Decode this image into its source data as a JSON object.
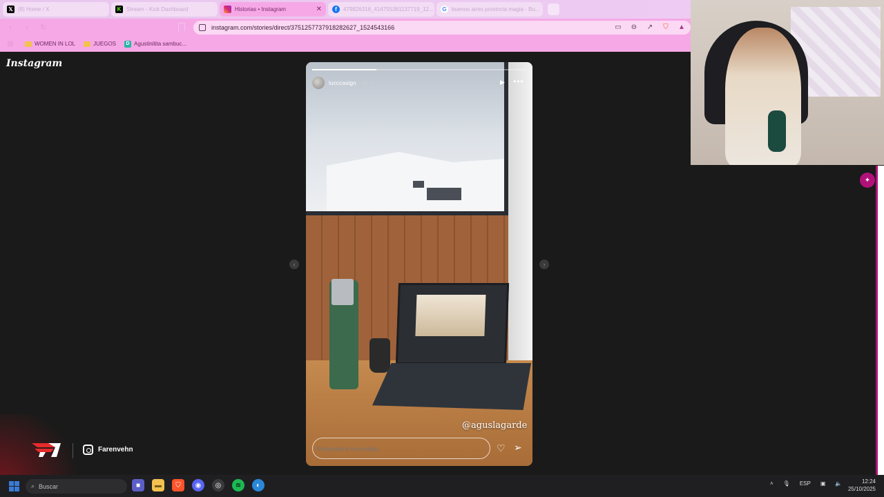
{
  "browser": {
    "tabs": [
      {
        "title": "(8) Home / X",
        "icon": "x-logo-icon"
      },
      {
        "title": "Stream - Kick Dashboard",
        "icon": "kick-logo-icon"
      },
      {
        "title": "Historias • Instagram",
        "icon": "instagram-logo-icon",
        "active": true
      },
      {
        "title": "479826316_414755381137719_12...",
        "icon": "facebook-logo-icon"
      },
      {
        "title": "buenos aires provincia magia - Bu...",
        "icon": "google-logo-icon"
      }
    ],
    "url": "instagram.com/stories/direct/3751257737918282627_1524543166",
    "bookmarks": [
      {
        "label": "WOMEN IN LOL",
        "icon": "folder-icon"
      },
      {
        "label": "JUEGOS",
        "icon": "folder-icon"
      },
      {
        "label": "Agustinitita sambuc...",
        "icon": "d-site-icon"
      }
    ]
  },
  "page": {
    "logo": "Instagram",
    "story": {
      "username": "lucccasign",
      "time": "45 s",
      "progress": 0.3,
      "mention": "@aguslagarde",
      "reply_placeholder": "Responde a lucccasign..."
    }
  },
  "overlay": {
    "brand": "F",
    "instagram_handle": "Farenvehn"
  },
  "taskbar": {
    "search_placeholder": "Buscar",
    "apps": [
      "teams-icon",
      "files-icon",
      "brave-icon",
      "discord-icon",
      "obs-icon",
      "spotify-icon",
      "edge-icon"
    ],
    "language": "ESP",
    "time": "12:24",
    "date": "25/10/2025"
  },
  "colors": {
    "accent": "#f6a8e6",
    "side_accent": "#b2117a",
    "spotify": "#1db954"
  }
}
